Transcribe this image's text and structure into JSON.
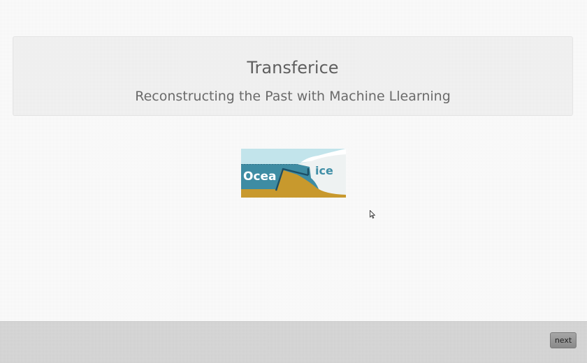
{
  "header": {
    "title": "Transferice",
    "subtitle": "Reconstructing the Past with Machine Llearning"
  },
  "logo": {
    "ocean_label": "Ocea",
    "ice_label": "ice",
    "colors": {
      "sky": "#bfe3ea",
      "ocean": "#3f8ea6",
      "seafloor": "#c99a2e",
      "ice": "#f1f4f4",
      "ice_text": "#3f8ea6",
      "outline": "#1d4f66"
    }
  },
  "footer": {
    "next_label": "next"
  },
  "icons": {
    "cursor": "mouse-pointer-icon"
  }
}
